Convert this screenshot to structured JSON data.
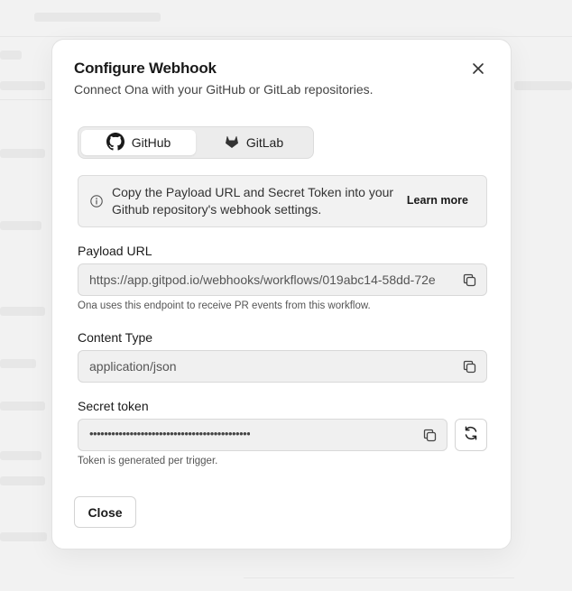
{
  "modal": {
    "title": "Configure Webhook",
    "subtitle": "Connect Ona with your GitHub or GitLab repositories."
  },
  "tabs": [
    {
      "label": "GitHub",
      "icon": "github-icon",
      "active": true
    },
    {
      "label": "GitLab",
      "icon": "gitlab-icon",
      "active": false
    }
  ],
  "info": {
    "text": "Copy the Payload URL and Secret Token into your Github repository's webhook settings.",
    "link": "Learn more"
  },
  "payload": {
    "label": "Payload URL",
    "value": "https://app.gitpod.io/webhooks/workflows/019abc14-58dd-72e",
    "help": "Ona uses this endpoint to receive PR events from this workflow."
  },
  "content_type": {
    "label": "Content Type",
    "value": "application/json"
  },
  "secret": {
    "label": "Secret token",
    "value": "••••••••••••••••••••••••••••••••••••••••••••",
    "help": "Token is generated per trigger."
  },
  "footer": {
    "close_label": "Close"
  },
  "colors": {
    "modal_bg": "#ffffff",
    "field_bg": "#f0f0f0",
    "border": "#d8d8d8",
    "text": "#1a1a1a"
  }
}
